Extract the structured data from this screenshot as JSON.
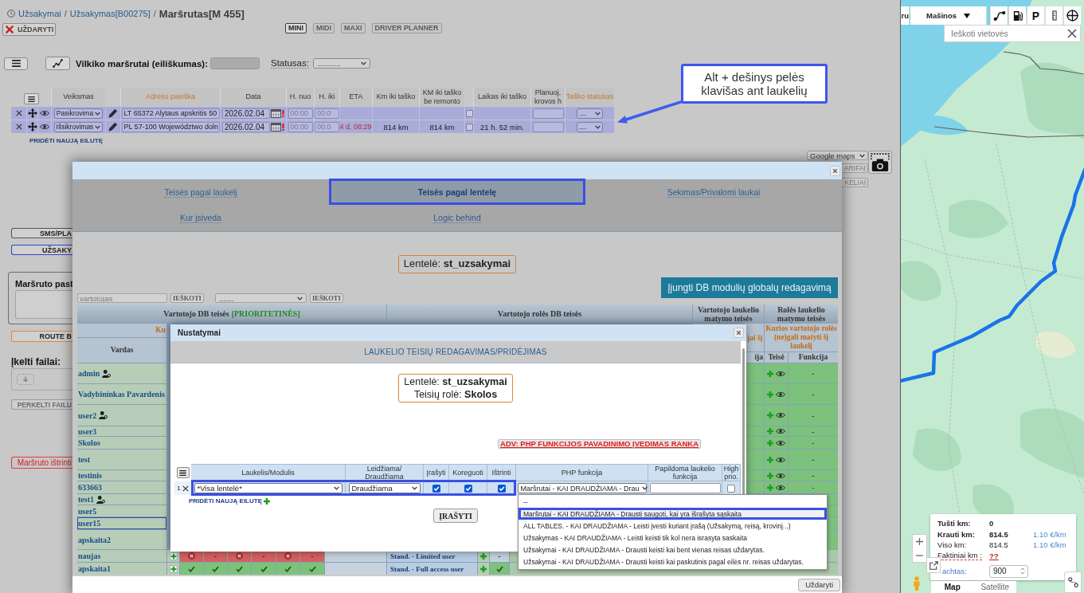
{
  "breadcrumb": [
    {
      "kind": "link",
      "text": "Užsakymai"
    },
    {
      "kind": "separator",
      "text": "/"
    },
    {
      "kind": "link",
      "text": "Užsakymas[B00275]"
    },
    {
      "kind": "separator",
      "text": "/"
    },
    {
      "kind": "current",
      "text": "Maršrutas[M 455]"
    }
  ],
  "toolbar": {
    "close_button": "UŽDARYTI",
    "view_buttons": [
      {
        "label": "MINI",
        "selected": true
      },
      {
        "label": "MIDI",
        "selected": false
      },
      {
        "label": "MAXI",
        "selected": false
      },
      {
        "label": "DRIVER PLANNER",
        "selected": false
      }
    ]
  },
  "route_filter": {
    "label": "Vilkiko maršrutai (eiliškumas):",
    "status_label": "Statusas:",
    "status_value": "............"
  },
  "route_table": {
    "columns": [
      {
        "label": "Veiksmas",
        "kind": "plain"
      },
      {
        "label": "Adreso paieška",
        "kind": "link"
      },
      {
        "label": "Data",
        "kind": "plain"
      },
      {
        "label": "H. nuo",
        "kind": "plain"
      },
      {
        "label": "H. iki",
        "kind": "plain"
      },
      {
        "label": "ETA",
        "kind": "plain"
      },
      {
        "label": "Km iki taško",
        "kind": "plain"
      },
      {
        "label": "KM iki taško be remonto",
        "kind": "plain"
      },
      {
        "label": "Laikas iki taško",
        "kind": "plain"
      },
      {
        "label": "Planuoj. krovos h",
        "kind": "plain"
      },
      {
        "label": "Taško statusas",
        "kind": "link"
      }
    ],
    "rows": [
      {
        "action": "Pasikrovima",
        "address": "LT 65372 Alytaus apskritis 50",
        "date": "2026.02.04",
        "time_from": "00:00",
        "time_to": "00:0",
        "checked": false,
        "status": "...."
      },
      {
        "action": "Išsikrovimas",
        "address": "PL 57-100 Województwo doln",
        "date": "2026.02.04",
        "time_from": "00:00",
        "time_to": "00:0",
        "eta": "4 d. 08:29",
        "km": "814 km",
        "km_without_repair": "814 km",
        "checked": false,
        "time_left": "21 h. 52 min.",
        "status": "...."
      }
    ],
    "add_row_link": "PRIDĖTI NAUJĄ EILUTĘ"
  },
  "callout": {
    "text": "Alt + dešinys pelės klavišas ant laukelių"
  },
  "side_panel": {
    "items": [
      {
        "kind": "button",
        "label": "SMS/PLA"
      },
      {
        "kind": "primary",
        "label": "UŽSAKY"
      },
      {
        "kind": "notes",
        "label": "Maršruto past"
      },
      {
        "kind": "warning",
        "label": "ROUTE B"
      },
      {
        "kind": "heading",
        "label": "Įkelti failai:"
      },
      {
        "kind": "upload"
      },
      {
        "kind": "muted",
        "label": "PERKELTI FAILU"
      },
      {
        "kind": "danger",
        "label": "Maršruto ištrinti"
      }
    ]
  },
  "map_controls": {
    "source_select": "Google maps",
    "buttons": [
      "ARIFAI",
      "KELIAI"
    ]
  },
  "permissions_dialog": {
    "tabs": [
      {
        "label": "Teisės pagal laukelį",
        "selected": false
      },
      {
        "label": "Teisės pagal lentelę",
        "selected": true
      },
      {
        "label": "Sekimas/Privalomi laukai",
        "selected": false
      },
      {
        "label": "Kur įsiveda",
        "selected": false
      },
      {
        "label": "Logic behind",
        "selected": false
      }
    ],
    "table_info": "Lentelė: **st_uzsakymai**",
    "global_edit_button": "Įjungti DB modulių globalų redagavimą",
    "user_search": {
      "placeholder": "vartotojas",
      "button": "IEŠKOTI"
    },
    "role_filter": {
      "value": ".......",
      "button": "IEŠKOTI"
    },
    "table": {
      "group_headers": {
        "user_db": "Vartotojo DB teisės",
        "user_db_note": "[PRIORITETINĖS]",
        "role_db": "Vartotojo rolės DB teisės",
        "user_field": "Vartotojo laukelio matymo teisės",
        "role_field": "Rolės laukelio matymo teisės"
      },
      "sub_headers": {
        "user_db": "Ku",
        "user_field": "jai šį",
        "role_field": "Kurios vartotojo rolės (ne)gali matyti šį laukelį"
      },
      "columns": {
        "name": "Vardas",
        "user_field_function": "ija",
        "role_field_right": "Teisė",
        "role_field_function": "Funkcija"
      },
      "rows": [
        {
          "name": "admin",
          "user_icon": true,
          "selected": false,
          "role_field_function": "-"
        },
        {
          "name": "Vadybininkas Pavardenis",
          "user_icon": false,
          "selected": false,
          "role_field_function": "-"
        },
        {
          "name": "user2",
          "user_icon": true,
          "selected": false,
          "role_field_function": "-"
        },
        {
          "name": "user3",
          "user_icon": false,
          "selected": false,
          "role_field_function": "-"
        },
        {
          "name": "Skolos",
          "user_icon": false,
          "selected": false,
          "role_field_function": "-"
        },
        {
          "name": "test",
          "user_icon": false,
          "selected": false,
          "role_field_function": "-"
        },
        {
          "name": "testinis",
          "user_icon": false,
          "selected": false,
          "role_field_function": "-"
        },
        {
          "name": "633663",
          "user_icon": false,
          "selected": false,
          "role_field_function": "-"
        },
        {
          "name": "test1",
          "user_icon": true,
          "selected": false
        },
        {
          "name": "user5",
          "user_icon": false,
          "selected": false
        },
        {
          "name": "user15",
          "user_icon": false,
          "selected": true
        },
        {
          "name": "apskaita2",
          "user_icon": false,
          "selected": false
        },
        {
          "name": "naujas",
          "user_icon": false,
          "selected": false,
          "permissions": [
            {
              "kind": "icon",
              "allowed": false
            },
            {
              "kind": "text",
              "text": "-",
              "allowed": false
            },
            {
              "kind": "icon",
              "allowed": false
            },
            {
              "kind": "text",
              "text": "-",
              "allowed": false
            },
            {
              "kind": "icon",
              "allowed": false
            },
            {
              "kind": "text",
              "text": "-",
              "allowed": false
            }
          ],
          "role": "Stand. - Limited user",
          "role_permissions": [
            {
              "kind": "text",
              "text": "-",
              "allowed": false
            }
          ]
        },
        {
          "name": "apskaita1",
          "user_icon": false,
          "selected": false,
          "permissions": [
            {
              "kind": "icon",
              "allowed": true
            },
            {
              "kind": "icon",
              "allowed": true
            },
            {
              "kind": "icon",
              "allowed": true
            },
            {
              "kind": "icon",
              "allowed": true
            },
            {
              "kind": "icon",
              "allowed": true
            },
            {
              "kind": "icon",
              "allowed": true
            }
          ],
          "role": "Stand. - Full access user",
          "role_permissions": [
            {
              "kind": "icon",
              "allowed": true
            }
          ]
        }
      ]
    },
    "close_button": "Uždaryti"
  },
  "settings_dialog": {
    "title": "Nustatymai",
    "heading": "LAUKELIO TEISIŲ REDAGAVIMAS/PRIDĖJIMAS",
    "info": [
      "Lentelė: **st_uzsakymai**",
      "Teisių rolė: **Skolos**"
    ],
    "manual_link": "ADV: PHP FUNKCIJOS PAVADINIMO ĮVEDIMAS RANKA",
    "columns": [
      "Laukelis/Modulis",
      "Leidžiama/ Draudžiama",
      "Įrašyti",
      "Koreguoti",
      "Ištrinti",
      "PHP funkcija",
      "Papildoma laukelio funkcija",
      "High prio."
    ],
    "rows": [
      {
        "index": "1",
        "field": "*Visa lentelė*",
        "permission": "Draudžiama",
        "create": true,
        "edit": true,
        "delete": true,
        "php_function": "Maršrutai - KAI DRAUDŽIAMA - Drau",
        "high_priority": false,
        "selected": true
      }
    ],
    "add_row_link": "PRIDĖTI NAUJĄ EILUTĘ",
    "save_button": "ĮRAŠYTI"
  },
  "dropdown": {
    "options": [
      {
        "label": "--",
        "selected": false
      },
      {
        "label": "Maršrutai - KAI DRAUDŽIAMA - Drausti saugoti, kai yra išrašyta sąskaita",
        "selected": true
      },
      {
        "label": "ALL TABLES. - KAI DRAUDŽIAMA - Leisti įvesti kuriant įrašą (Užsakymą, reisą, krovinį...)",
        "selected": false
      },
      {
        "label": "Užsakymas - KAI DRAUDŽIAMA - Leisti keisti tik kol nera israsyta saskaita",
        "selected": false
      },
      {
        "label": "Užsakymai - KAI DRAUDŽIAMA - Drausti keisti kai bent vienas reisas uždarytas.",
        "selected": false
      },
      {
        "label": "Užsakymai - KAI DRAUDŽIAMA - Drausti keisti kai paskutinis pagal eilės nr. reisas uždarytas.",
        "selected": false
      }
    ]
  },
  "map": {
    "cut_tab": "ru",
    "vehicles_select": "Mašinos",
    "parking_label": "P",
    "search": {
      "placeholder": "Ieškoti vietovės"
    },
    "stats": [
      {
        "label": "Tušti km:",
        "value": "0",
        "kind": "strong"
      },
      {
        "label": "Krauti km:",
        "value": "814.5",
        "rate": "1.10 €/km",
        "kind": "strong"
      },
      {
        "label": "Viso km:",
        "value": "814.5",
        "rate": "1.10 €/km",
        "kind": "normal"
      },
      {
        "label": "Faktiniai km :",
        "value": "??",
        "kind": "missing"
      }
    ],
    "freight": {
      "label": "achtas:",
      "value": "900"
    },
    "map_types": [
      {
        "label": "Map",
        "selected": true
      },
      {
        "label": "Satellite",
        "selected": false
      }
    ]
  }
}
